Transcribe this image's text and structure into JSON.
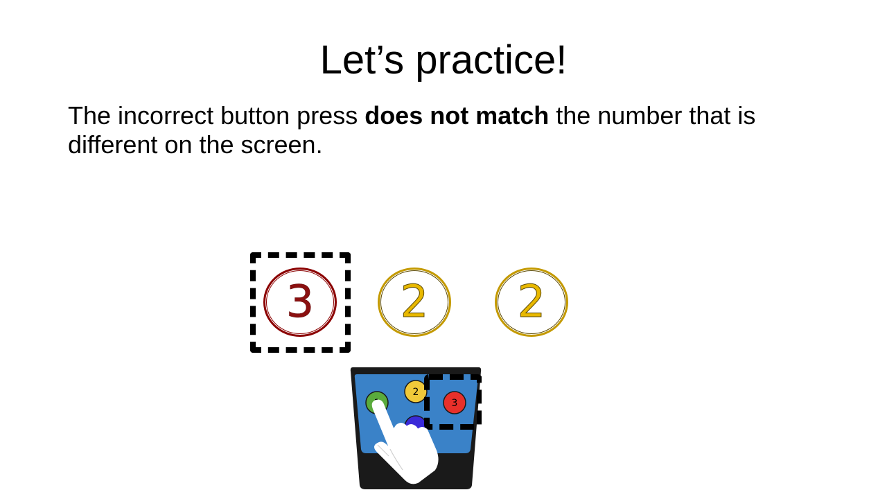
{
  "slide": {
    "title": "Let’s practice!",
    "instruction": {
      "before_bold": "The incorrect button press ",
      "bold": "does not match",
      "after_bold": " the number that is different on the screen."
    }
  },
  "stimuli": [
    {
      "number": "3",
      "color": "#8b1010",
      "highlighted": true
    },
    {
      "number": "2",
      "color": "#e8b800",
      "highlighted": false
    },
    {
      "number": "2",
      "color": "#e8b800",
      "highlighted": false
    }
  ],
  "response_pad": {
    "body_color": "#1a1a1a",
    "screen_color": "#3a82c8",
    "buttons": [
      {
        "label": "1",
        "color": "#5aab3c"
      },
      {
        "label": "2",
        "color": "#f0c93a"
      },
      {
        "label": "3",
        "color": "#e8302a",
        "highlighted": true
      },
      {
        "label": "",
        "color": "#3a2ad8"
      }
    ],
    "pressed_button": "1"
  }
}
